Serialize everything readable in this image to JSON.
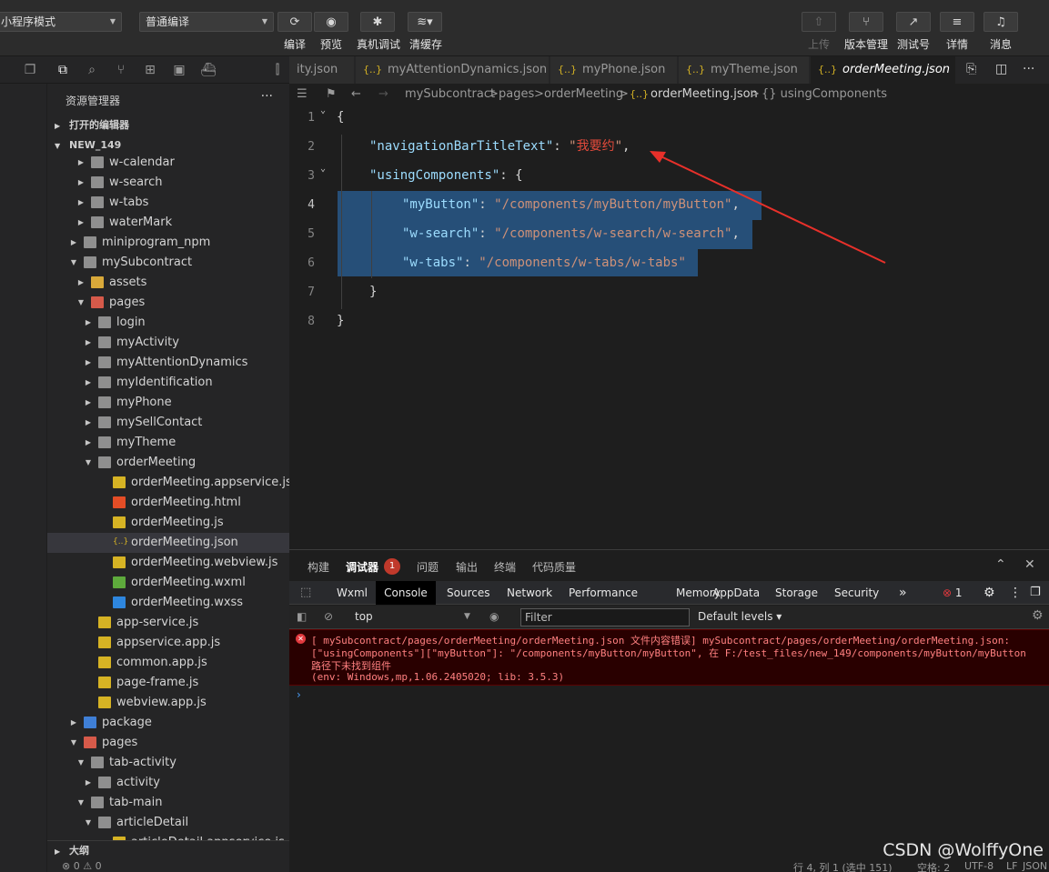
{
  "toolbar": {
    "mode_select": "小程序模式",
    "compile_select": "普通编译",
    "buttons": {
      "compile": "编译",
      "preview": "预览",
      "device_debug": "真机调试",
      "clear_cache": "清缓存",
      "upload": "上传",
      "version": "版本管理",
      "test_account": "测试号",
      "details": "详情",
      "messages": "消息"
    }
  },
  "sidebar": {
    "title": "资源管理器",
    "more": "···",
    "open_editors": "打开的编辑器",
    "project": "NEW_149",
    "outline": "大纲",
    "tree": [
      {
        "label": "w-calendar",
        "depth": 3,
        "kind": "folder",
        "expanded": false
      },
      {
        "label": "w-search",
        "depth": 3,
        "kind": "folder",
        "expanded": false
      },
      {
        "label": "w-tabs",
        "depth": 3,
        "kind": "folder",
        "expanded": false
      },
      {
        "label": "waterMark",
        "depth": 3,
        "kind": "folder",
        "expanded": false
      },
      {
        "label": "miniprogram_npm",
        "depth": 2,
        "kind": "folder",
        "expanded": false
      },
      {
        "label": "mySubcontract",
        "depth": 2,
        "kind": "folder",
        "expanded": true
      },
      {
        "label": "assets",
        "depth": 3,
        "kind": "folder-yellow",
        "expanded": false
      },
      {
        "label": "pages",
        "depth": 3,
        "kind": "folder-red",
        "expanded": true
      },
      {
        "label": "login",
        "depth": 4,
        "kind": "folder",
        "expanded": false
      },
      {
        "label": "myActivity",
        "depth": 4,
        "kind": "folder",
        "expanded": false
      },
      {
        "label": "myAttentionDynamics",
        "depth": 4,
        "kind": "folder",
        "expanded": false
      },
      {
        "label": "myIdentification",
        "depth": 4,
        "kind": "folder",
        "expanded": false
      },
      {
        "label": "myPhone",
        "depth": 4,
        "kind": "folder",
        "expanded": false
      },
      {
        "label": "mySellContact",
        "depth": 4,
        "kind": "folder",
        "expanded": false
      },
      {
        "label": "myTheme",
        "depth": 4,
        "kind": "folder",
        "expanded": false
      },
      {
        "label": "orderMeeting",
        "depth": 4,
        "kind": "folder",
        "expanded": true
      },
      {
        "label": "orderMeeting.appservice.js",
        "depth": 5,
        "kind": "js"
      },
      {
        "label": "orderMeeting.html",
        "depth": 5,
        "kind": "html"
      },
      {
        "label": "orderMeeting.js",
        "depth": 5,
        "kind": "js"
      },
      {
        "label": "orderMeeting.json",
        "depth": 5,
        "kind": "json",
        "selected": true
      },
      {
        "label": "orderMeeting.webview.js",
        "depth": 5,
        "kind": "js"
      },
      {
        "label": "orderMeeting.wxml",
        "depth": 5,
        "kind": "wxml"
      },
      {
        "label": "orderMeeting.wxss",
        "depth": 5,
        "kind": "wxss"
      },
      {
        "label": "app-service.js",
        "depth": 3,
        "kind": "js"
      },
      {
        "label": "appservice.app.js",
        "depth": 3,
        "kind": "js"
      },
      {
        "label": "common.app.js",
        "depth": 3,
        "kind": "js"
      },
      {
        "label": "page-frame.js",
        "depth": 3,
        "kind": "js"
      },
      {
        "label": "webview.app.js",
        "depth": 3,
        "kind": "js"
      },
      {
        "label": "package",
        "depth": 2,
        "kind": "folder-blue",
        "expanded": false
      },
      {
        "label": "pages",
        "depth": 2,
        "kind": "folder-red",
        "expanded": true
      },
      {
        "label": "tab-activity",
        "depth": 3,
        "kind": "folder",
        "expanded": true
      },
      {
        "label": "activity",
        "depth": 4,
        "kind": "folder",
        "expanded": false
      },
      {
        "label": "tab-main",
        "depth": 3,
        "kind": "folder",
        "expanded": true
      },
      {
        "label": "articleDetail",
        "depth": 4,
        "kind": "folder",
        "expanded": true
      },
      {
        "label": "articleDetail.appservice.js",
        "depth": 5,
        "kind": "js"
      }
    ]
  },
  "tabs": [
    {
      "label": "ity.json",
      "active": false
    },
    {
      "label": "myAttentionDynamics.json",
      "active": false
    },
    {
      "label": "myPhone.json",
      "active": false
    },
    {
      "label": "myTheme.json",
      "active": false
    },
    {
      "label": "orderMeeting.json",
      "active": true
    }
  ],
  "tab_close": "✕",
  "breadcrumb": {
    "folder": "mySubcontract",
    "sep1": ">",
    "pages": "pages",
    "sep2": ">",
    "page": "orderMeeting",
    "sep3": ">",
    "file": "orderMeeting.json",
    "sep4": ">",
    "symbol": "{} usingComponents"
  },
  "code": {
    "lines": [
      "1",
      "2",
      "3",
      "4",
      "5",
      "6",
      "7",
      "8"
    ],
    "open_brace": "{",
    "key_title": "\"navigationBarTitleText\"",
    "colon": ": ",
    "value_title_q1": "\"",
    "value_title": "我要约",
    "value_title_q2": "\"",
    "comma": ",",
    "key_using": "\"usingComponents\"",
    "using_open": ": {",
    "key_mybutton": "\"myButton\"",
    "val_mybutton": "\"/components/myButton/myButton\"",
    "key_wsearch": "\"w-search\"",
    "val_wsearch": "\"/components/w-search/w-search\"",
    "key_wtabs": "\"w-tabs\"",
    "val_wtabs": "\"/components/w-tabs/w-tabs\"",
    "inner_close": "}",
    "close_brace": "}"
  },
  "panel": {
    "tabs": [
      "构建",
      "调试器",
      "问题",
      "输出",
      "终端",
      "代码质量"
    ],
    "active_tab": "调试器",
    "debugger_badge": "1",
    "devtools_tabs": [
      "Wxml",
      "Console",
      "Sources",
      "Network",
      "Performance",
      "Memory",
      "AppData",
      "Storage",
      "Security"
    ],
    "active_devtools_tab": "Console",
    "more": "»",
    "error_count": "1",
    "context": "top",
    "filter_placeholder": "Filter",
    "levels": "Default levels ▾",
    "error_lines": [
      "[ mySubcontract/pages/orderMeeting/orderMeeting.json 文件内容错误] mySubcontract/pages/orderMeeting/orderMeeting.json:",
      "[\"usingComponents\"][\"myButton\"]: \"/components/myButton/myButton\", 在 F:/test_files/new_149/components/myButton/myButton",
      "路径下未找到组件",
      "(env: Windows,mp,1.06.2405020; lib: 3.5.3)"
    ],
    "prompt": "›"
  },
  "status": {
    "left": "⊗ 0 ⚠ 0",
    "position": "行 4, 列 1 (选中 151)",
    "spaces": "空格: 2",
    "encoding": "UTF-8",
    "eol": "LF",
    "language": "JSON"
  },
  "watermark": "CSDN @WolffyOne",
  "colors": {
    "accent_red": "#e24a3b",
    "selection": "#264f78",
    "error_bg": "#290000"
  }
}
